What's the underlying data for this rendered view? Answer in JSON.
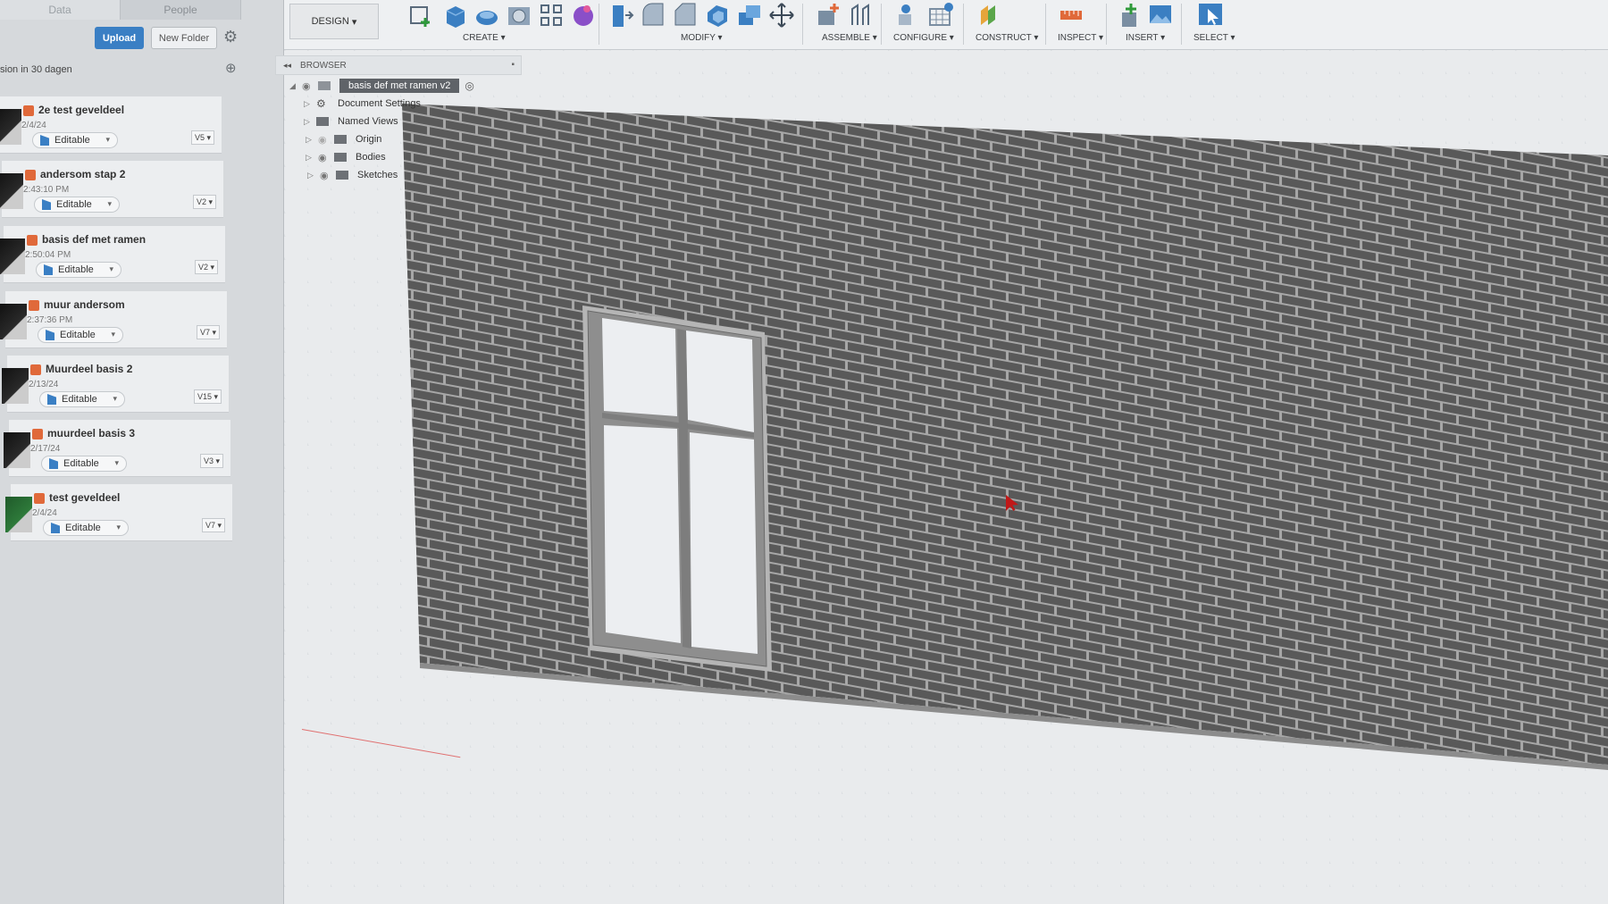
{
  "data_panel": {
    "tabs": [
      "Data",
      "People"
    ],
    "upload_label": "Upload",
    "new_folder_label": "New Folder",
    "recent_label": "sion in 30 dagen",
    "files": [
      {
        "name": "2e test geveldeel",
        "date": "2/4/24",
        "status": "Editable",
        "version": "V5"
      },
      {
        "name": "andersom stap 2",
        "date": "2:43:10 PM",
        "status": "Editable",
        "version": "V2"
      },
      {
        "name": "basis def met ramen",
        "date": "2:50:04 PM",
        "status": "Editable",
        "version": "V2"
      },
      {
        "name": "muur andersom",
        "date": "2:37:36 PM",
        "status": "Editable",
        "version": "V7"
      },
      {
        "name": "Muurdeel basis 2",
        "date": "2/13/24",
        "status": "Editable",
        "version": "V15"
      },
      {
        "name": "muurdeel basis 3",
        "date": "2/17/24",
        "status": "Editable",
        "version": "V3"
      },
      {
        "name": "test geveldeel",
        "date": "2/4/24",
        "status": "Editable",
        "version": "V7"
      }
    ]
  },
  "toolbar": {
    "workspace_label": "DESIGN",
    "groups": [
      {
        "label": "CREATE ▾"
      },
      {
        "label": "MODIFY ▾"
      },
      {
        "label": "ASSEMBLE ▾"
      },
      {
        "label": "CONFIGURE ▾"
      },
      {
        "label": "CONSTRUCT ▾"
      },
      {
        "label": "INSPECT ▾"
      },
      {
        "label": "INSERT ▾"
      },
      {
        "label": "SELECT ▾"
      }
    ]
  },
  "browser": {
    "header": "BROWSER",
    "root": "basis def met ramen v2",
    "items": [
      "Document Settings",
      "Named Views",
      "Origin",
      "Bodies",
      "Sketches"
    ]
  },
  "colors": {
    "accent": "#3a7fc4",
    "brick": "#595959",
    "mortar": "#a7a7a7",
    "cursor": "#c01818"
  }
}
